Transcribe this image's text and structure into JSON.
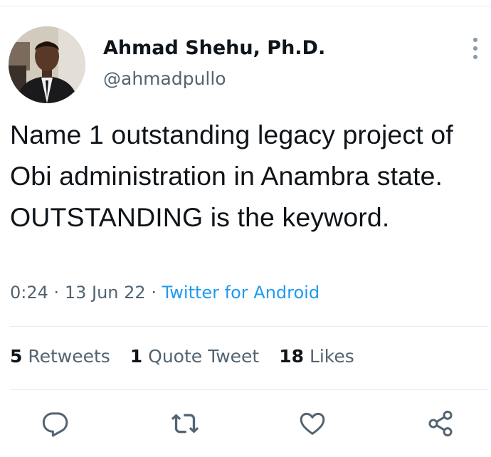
{
  "tweet": {
    "author": {
      "display_name": "Ahmad Shehu, Ph.D.",
      "handle": "@ahmadpullo",
      "avatar_icon": "profile-photo"
    },
    "text": "Name 1 outstanding legacy project of Obi administration in Anambra state. OUTSTANDING is the keyword.",
    "time": "0:24",
    "separator": "·",
    "date": "13 Jun 22",
    "source": "Twitter for Android",
    "stats": {
      "retweets": {
        "count": "5",
        "label": "Retweets"
      },
      "quotes": {
        "count": "1",
        "label": "Quote Tweet"
      },
      "likes": {
        "count": "18",
        "label": "Likes"
      }
    }
  },
  "actions": {
    "reply_icon": "reply-icon",
    "retweet_icon": "retweet-icon",
    "like_icon": "heart-icon",
    "share_icon": "share-icon",
    "more_icon": "more-vertical-icon"
  },
  "colors": {
    "text": "#0f1419",
    "secondary": "#536471",
    "link": "#1d9bf0",
    "divider": "#e6ecf0"
  }
}
